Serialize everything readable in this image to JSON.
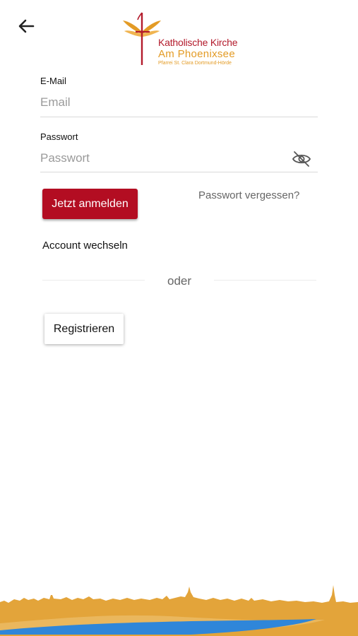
{
  "header": {
    "back_icon": "arrow-left-icon",
    "logo": {
      "line1": "Katholische Kirche",
      "line2": "Am Phoenixsee",
      "line3": "Pfarrei St. Clara Dortmund-Hörde"
    }
  },
  "form": {
    "email": {
      "label": "E-Mail",
      "placeholder": "Email",
      "value": ""
    },
    "password": {
      "label": "Passwort",
      "placeholder": "Passwort",
      "value": "",
      "toggle_icon": "eye-off-icon"
    }
  },
  "actions": {
    "login_label": "Jetzt anmelden",
    "forgot_label": "Passwort vergessen?",
    "switch_account_label": "Account wechseln",
    "divider_label": "oder",
    "register_label": "Registrieren"
  },
  "colors": {
    "primary": "#b30d22",
    "logo_red": "#b31b2c",
    "logo_orange": "#e39b25",
    "skyline_gold": "#e3a43a",
    "water_blue": "#2f86d9"
  }
}
